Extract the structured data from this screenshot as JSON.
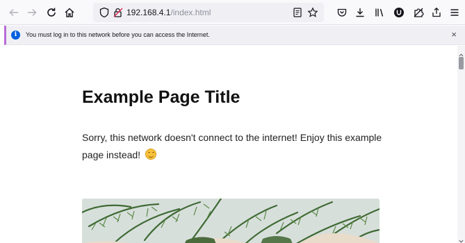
{
  "browser": {
    "url_host": "192.168.4.1",
    "url_path": "/index.html"
  },
  "notification": {
    "icon": "info-icon",
    "text": "You must log in to this network before you can access the Internet.",
    "close_label": "×",
    "accent_color": "#b86bd6"
  },
  "page": {
    "title": "Example Page Title",
    "body": "Sorry, this network doesn't connect to the internet! Enjoy this example page instead!",
    "emoji": "smiling-face-emoji"
  },
  "icons": [
    "back-icon",
    "forward-icon",
    "reload-icon",
    "home-icon",
    "tracking-protection-icon",
    "connection-icon",
    "reader-view-icon",
    "bookmark-star-icon",
    "pocket-icon",
    "downloads-icon",
    "library-icon",
    "ublock-icon",
    "extension-icon",
    "share-icon",
    "menu-icon"
  ]
}
